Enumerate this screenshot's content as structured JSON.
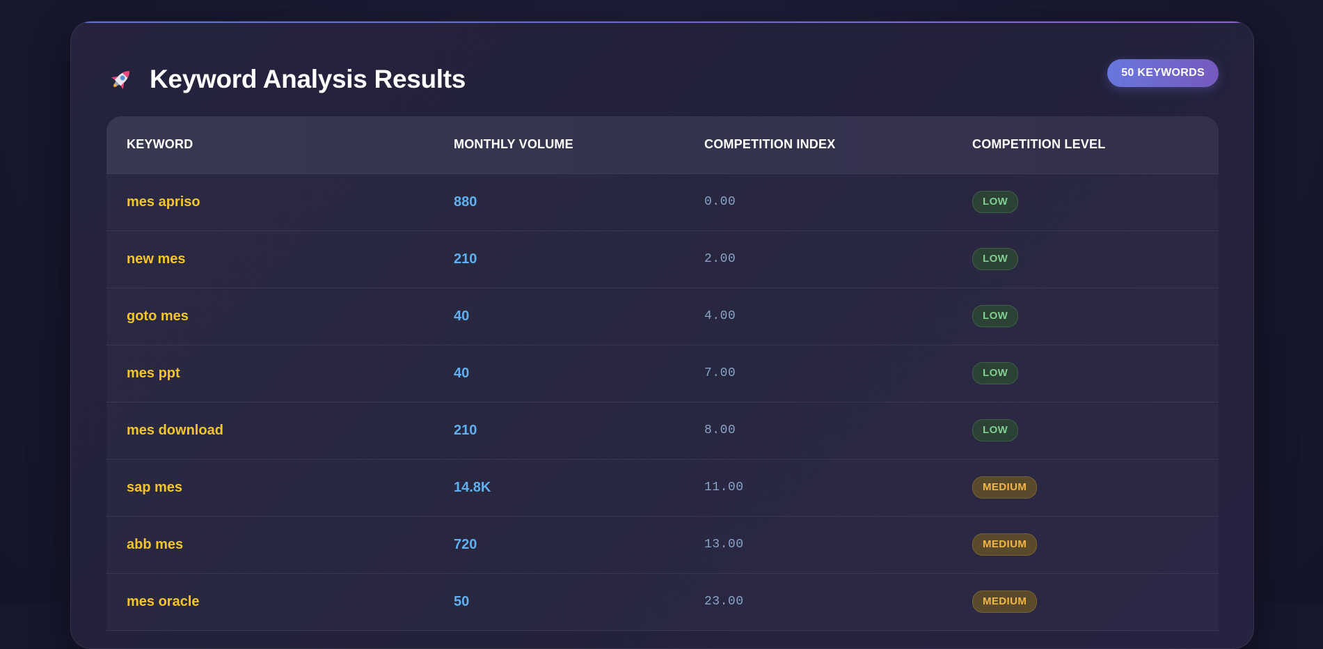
{
  "header": {
    "icon": "rocket-icon",
    "title": "Keyword Analysis Results",
    "badge": "50 KEYWORDS"
  },
  "table": {
    "columns": [
      "KEYWORD",
      "MONTHLY VOLUME",
      "COMPETITION INDEX",
      "COMPETITION LEVEL"
    ],
    "rows": [
      {
        "keyword": "mes apriso",
        "volume": "880",
        "index": "0.00",
        "level": "LOW",
        "level_type": "low"
      },
      {
        "keyword": "new mes",
        "volume": "210",
        "index": "2.00",
        "level": "LOW",
        "level_type": "low"
      },
      {
        "keyword": "goto mes",
        "volume": "40",
        "index": "4.00",
        "level": "LOW",
        "level_type": "low"
      },
      {
        "keyword": "mes ppt",
        "volume": "40",
        "index": "7.00",
        "level": "LOW",
        "level_type": "low"
      },
      {
        "keyword": "mes download",
        "volume": "210",
        "index": "8.00",
        "level": "LOW",
        "level_type": "low"
      },
      {
        "keyword": "sap mes",
        "volume": "14.8K",
        "index": "11.00",
        "level": "MEDIUM",
        "level_type": "medium"
      },
      {
        "keyword": "abb mes",
        "volume": "720",
        "index": "13.00",
        "level": "MEDIUM",
        "level_type": "medium"
      },
      {
        "keyword": "mes oracle",
        "volume": "50",
        "index": "23.00",
        "level": "MEDIUM",
        "level_type": "medium"
      }
    ]
  },
  "colors": {
    "background": "#17162c",
    "card": "#24223c",
    "accent_gradient_start": "#6877de",
    "accent_gradient_end": "#7659bd",
    "keyword": "#f3c52a",
    "volume": "#5fb0f0",
    "index": "#88a4c8",
    "low_text": "#7fcf8e",
    "medium_text": "#f2b548"
  }
}
